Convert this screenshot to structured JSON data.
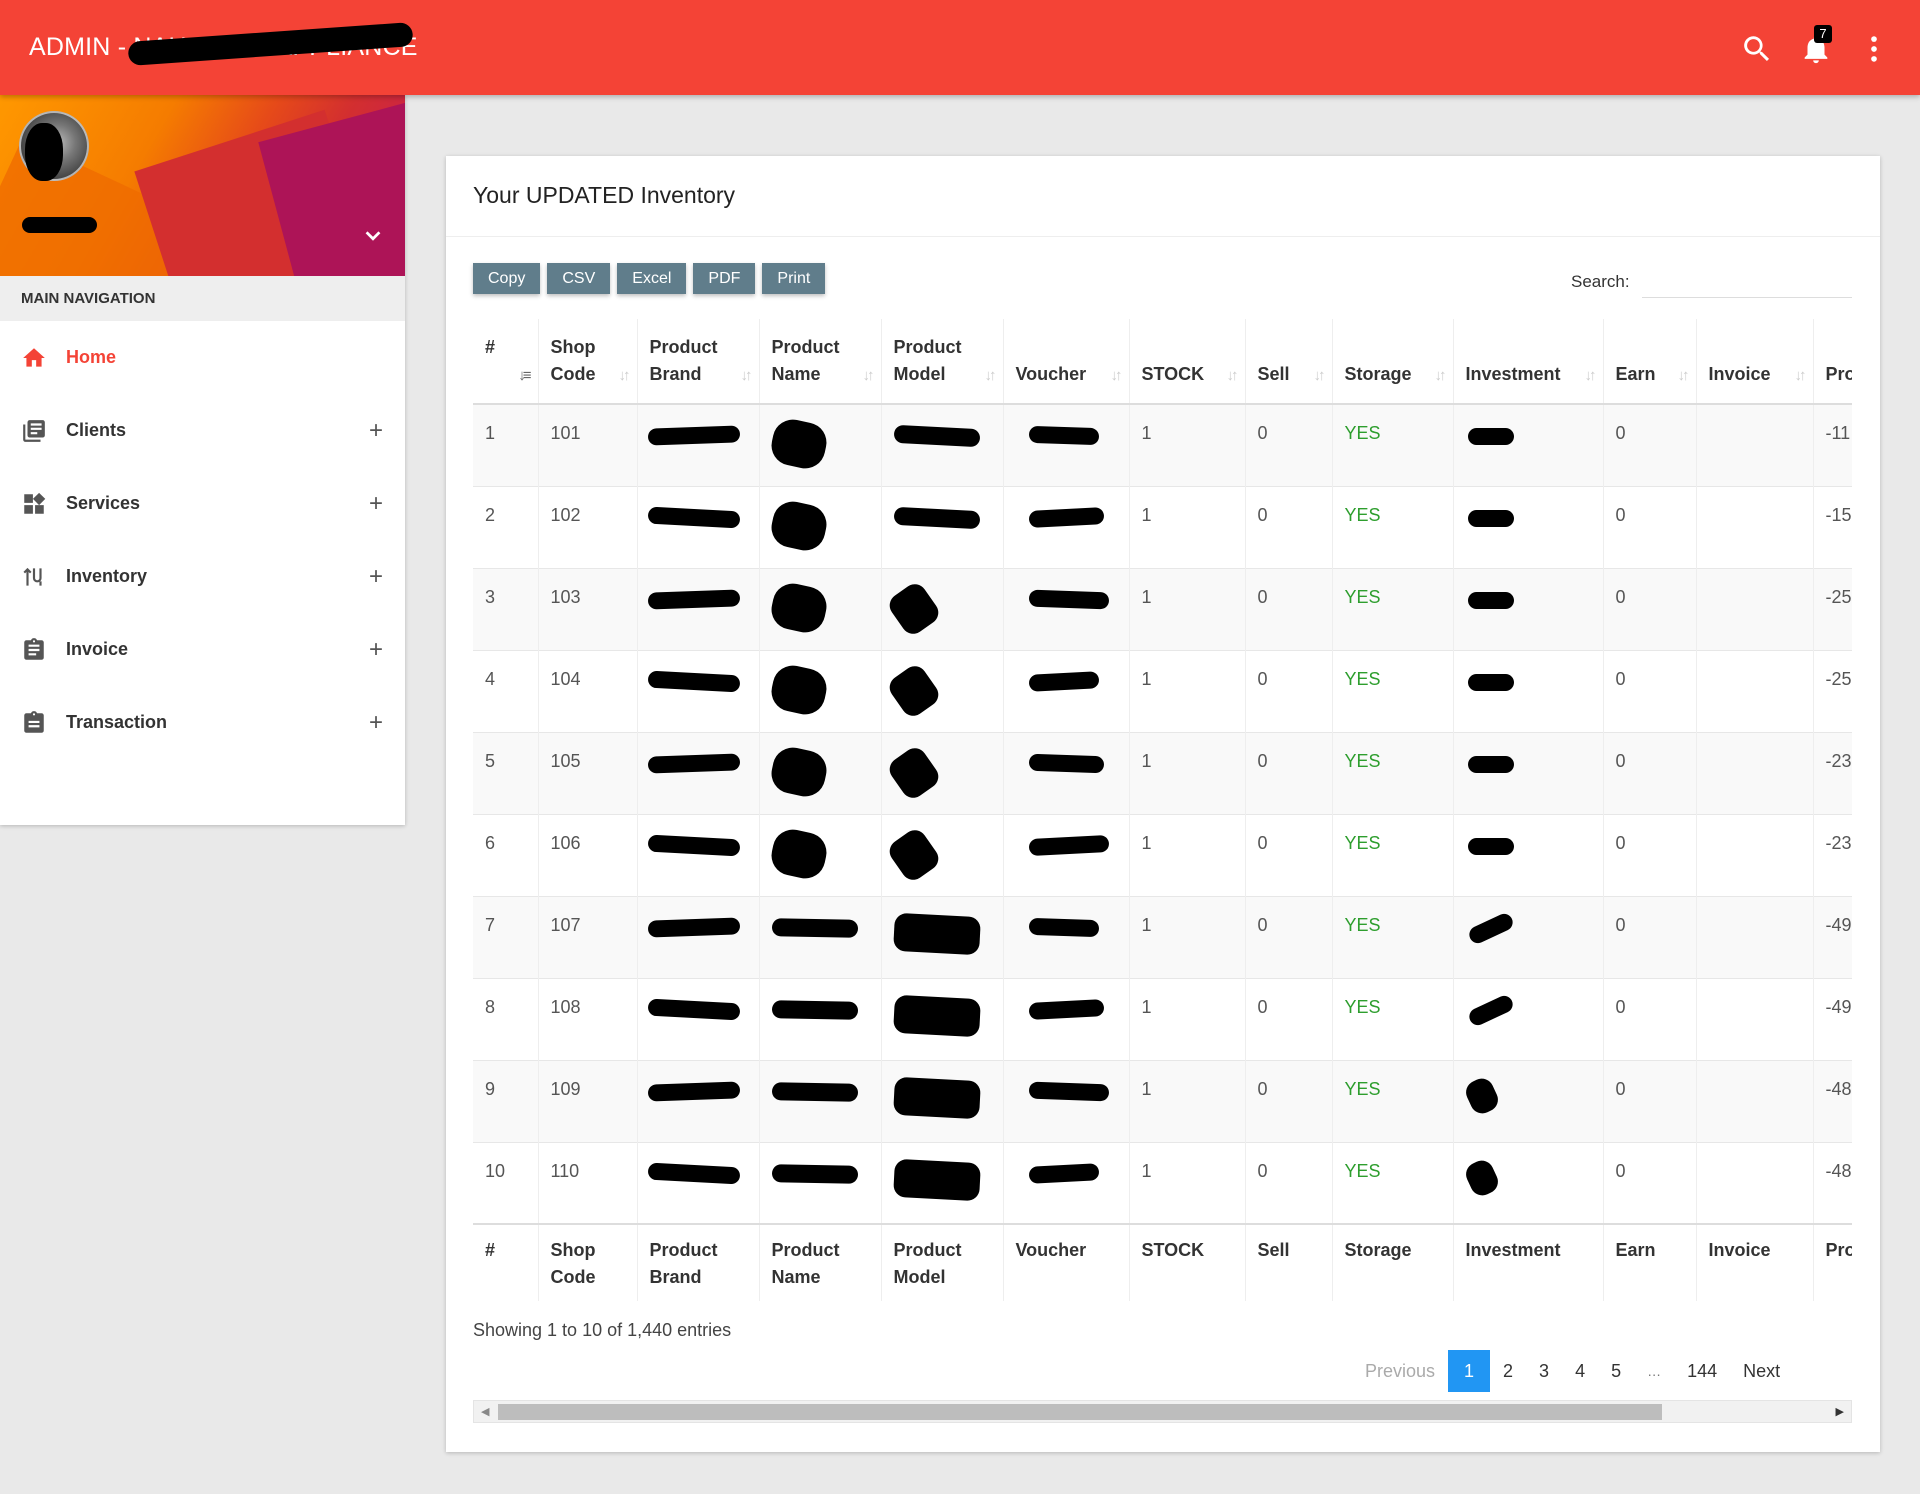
{
  "app": {
    "title": "ADMIN - NAH HOME APPLIANCE",
    "notification_count": "7",
    "accent_color": "#f44336"
  },
  "sidebar": {
    "nav_header": "MAIN NAVIGATION",
    "items": [
      {
        "label": "Home",
        "icon": "home-icon"
      },
      {
        "label": "Clients",
        "icon": "clients-icon"
      },
      {
        "label": "Services",
        "icon": "services-icon"
      },
      {
        "label": "Inventory",
        "icon": "inventory-icon"
      },
      {
        "label": "Invoice",
        "icon": "invoice-icon"
      },
      {
        "label": "Transaction",
        "icon": "transaction-icon"
      }
    ],
    "expand_symbol": "+"
  },
  "main": {
    "card_title": "Your UPDATED Inventory",
    "export_buttons": [
      "Copy",
      "CSV",
      "Excel",
      "PDF",
      "Print"
    ],
    "search_label": "Search:",
    "columns": [
      "#",
      "Shop Code",
      "Product Brand",
      "Product Name",
      "Product Model",
      "Voucher",
      "STOCK",
      "Sell",
      "Storage",
      "Investment",
      "Earn",
      "Invoice",
      "Pro"
    ],
    "rows": [
      {
        "n": "1",
        "shop": "101",
        "stock": "1",
        "sell": "0",
        "storage": "YES",
        "earn": "0",
        "pro": "-11"
      },
      {
        "n": "2",
        "shop": "102",
        "stock": "1",
        "sell": "0",
        "storage": "YES",
        "earn": "0",
        "pro": "-15"
      },
      {
        "n": "3",
        "shop": "103",
        "stock": "1",
        "sell": "0",
        "storage": "YES",
        "earn": "0",
        "pro": "-25"
      },
      {
        "n": "4",
        "shop": "104",
        "stock": "1",
        "sell": "0",
        "storage": "YES",
        "earn": "0",
        "pro": "-25"
      },
      {
        "n": "5",
        "shop": "105",
        "stock": "1",
        "sell": "0",
        "storage": "YES",
        "earn": "0",
        "pro": "-23"
      },
      {
        "n": "6",
        "shop": "106",
        "stock": "1",
        "sell": "0",
        "storage": "YES",
        "earn": "0",
        "pro": "-23"
      },
      {
        "n": "7",
        "shop": "107",
        "stock": "1",
        "sell": "0",
        "storage": "YES",
        "earn": "0",
        "pro": "-49"
      },
      {
        "n": "8",
        "shop": "108",
        "stock": "1",
        "sell": "0",
        "storage": "YES",
        "earn": "0",
        "pro": "-49"
      },
      {
        "n": "9",
        "shop": "109",
        "stock": "1",
        "sell": "0",
        "storage": "YES",
        "earn": "0",
        "pro": "-48"
      },
      {
        "n": "10",
        "shop": "110",
        "stock": "1",
        "sell": "0",
        "storage": "YES",
        "earn": "0",
        "pro": "-48"
      }
    ],
    "info": "Showing 1 to 10 of 1,440 entries",
    "pagination": {
      "previous": "Previous",
      "pages": [
        "1",
        "2",
        "3",
        "4",
        "5"
      ],
      "ellipsis": "…",
      "last": "144",
      "next": "Next",
      "current": "1"
    }
  }
}
